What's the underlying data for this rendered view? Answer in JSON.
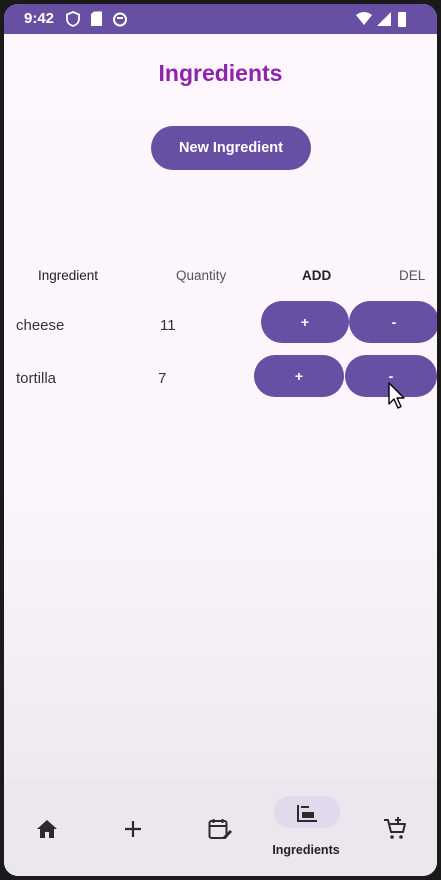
{
  "status_bar": {
    "time": "9:42"
  },
  "page": {
    "title": "Ingredients"
  },
  "new_button_label": "New Ingredient",
  "table": {
    "headers": {
      "ingredient": "Ingredient",
      "quantity": "Quantity",
      "add": "ADD",
      "del": "DEL"
    },
    "rows": [
      {
        "ingredient": "cheese",
        "quantity": "11",
        "add_label": "+",
        "del_label": "-"
      },
      {
        "ingredient": "tortilla",
        "quantity": "7",
        "add_label": "+",
        "del_label": "-"
      }
    ]
  },
  "bottom_nav": {
    "items": [
      {
        "icon": "home-icon",
        "label": ""
      },
      {
        "icon": "plus-icon",
        "label": ""
      },
      {
        "icon": "calendar-edit-icon",
        "label": ""
      },
      {
        "icon": "ingredients-icon",
        "label": "Ingredients",
        "selected": true
      },
      {
        "icon": "cart-add-icon",
        "label": ""
      }
    ]
  },
  "colors": {
    "primary": "#6750a4",
    "title": "#8e24aa",
    "background": "#fdf7fd",
    "nav_background": "#ece6ee"
  }
}
